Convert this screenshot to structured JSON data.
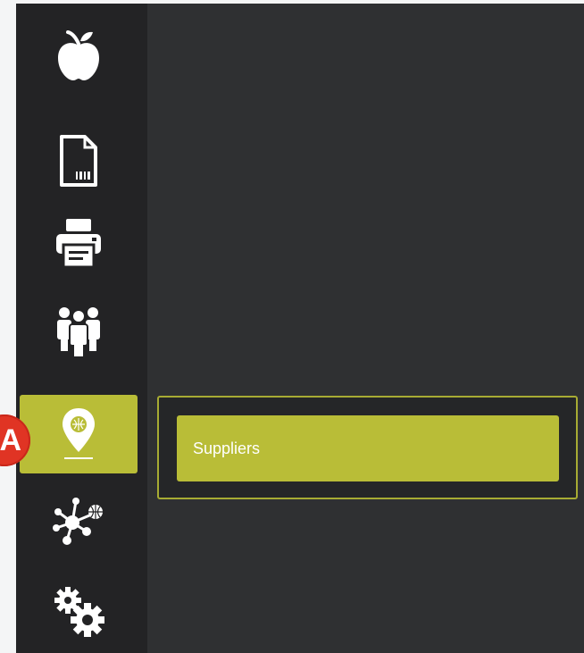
{
  "colors": {
    "page_background": "#f4f5f6",
    "sidebar_background": "#232325",
    "content_background": "#2f3032",
    "accent": "#b9bd37",
    "badge": "#e03424"
  },
  "sidebar": {
    "items": [
      {
        "icon": "apple-icon",
        "active": false
      },
      {
        "icon": "barcode-document-icon",
        "active": false
      },
      {
        "icon": "printer-icon",
        "active": false
      },
      {
        "icon": "people-icon",
        "active": false
      },
      {
        "icon": "location-pin-icon",
        "active": true
      },
      {
        "icon": "network-icon",
        "active": false
      },
      {
        "icon": "gears-icon",
        "active": false
      }
    ]
  },
  "callout_badge": {
    "label": "A"
  },
  "submenu": {
    "items": [
      {
        "label": "Suppliers",
        "active": true
      }
    ]
  }
}
